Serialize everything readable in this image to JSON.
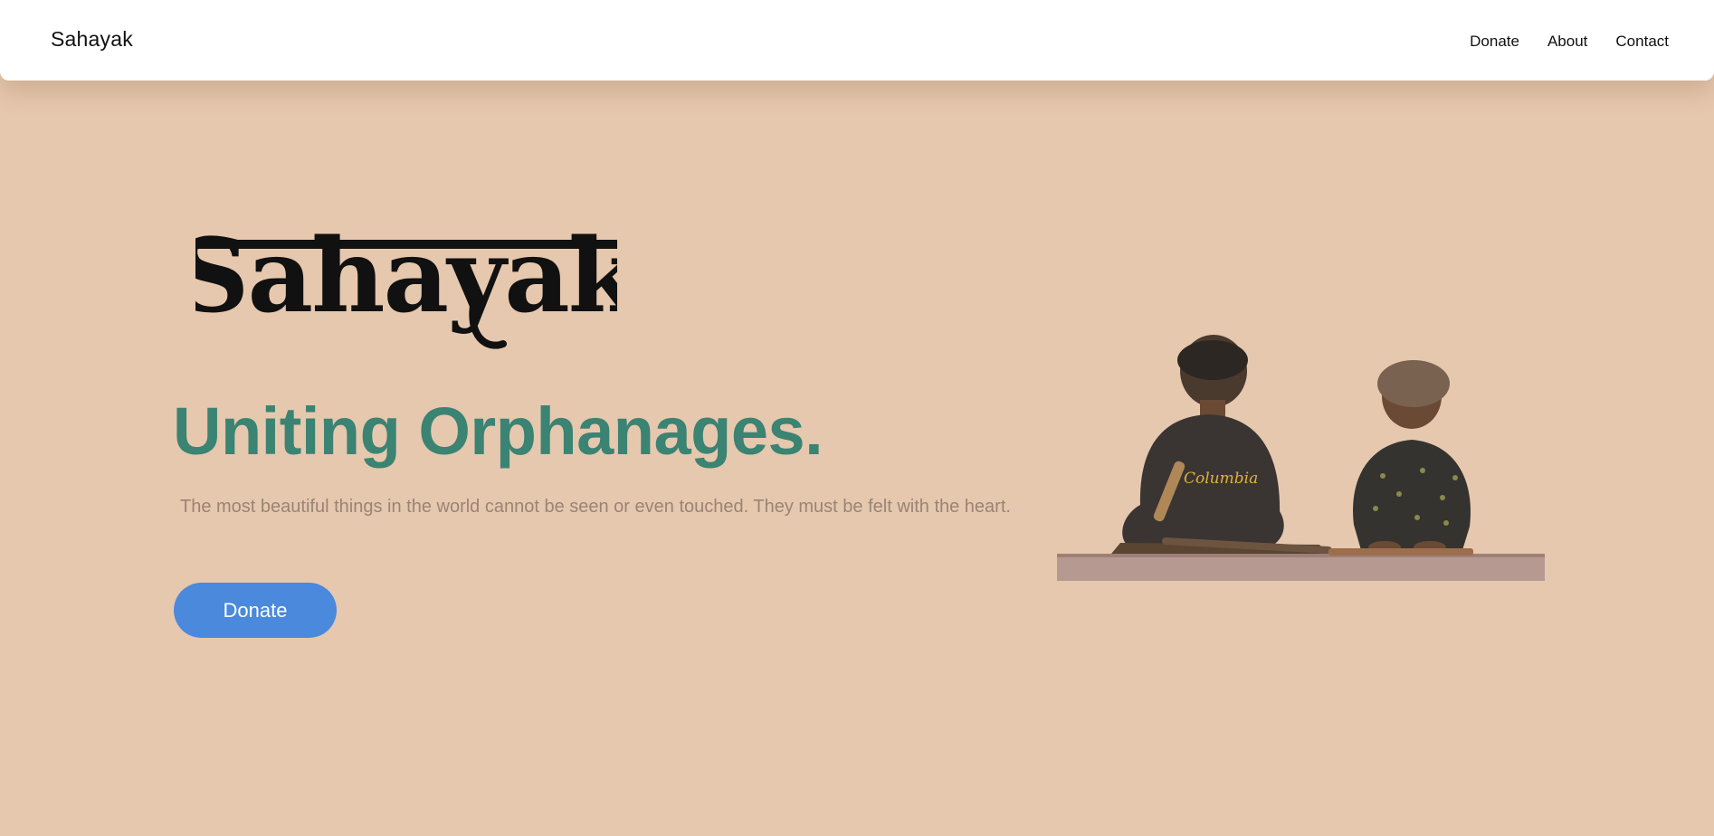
{
  "nav": {
    "brand": "Sahayak",
    "links": [
      "Donate",
      "About",
      "Contact"
    ]
  },
  "hero": {
    "logo_text": "Sahayak",
    "headline": "Uniting Orphanages.",
    "subtext": "The most beautiful things in the world cannot be seen or even touched. They must be felt with the heart.",
    "cta_label": "Donate",
    "photo_brand_text": "Columbia"
  },
  "colors": {
    "background": "#e6c8ae",
    "navbar": "#ffffff",
    "headline": "#3b8372",
    "subtext": "#9a8476",
    "button": "#4a89dc"
  },
  "icons": [
    "sahayak-logo",
    "children-photo"
  ]
}
